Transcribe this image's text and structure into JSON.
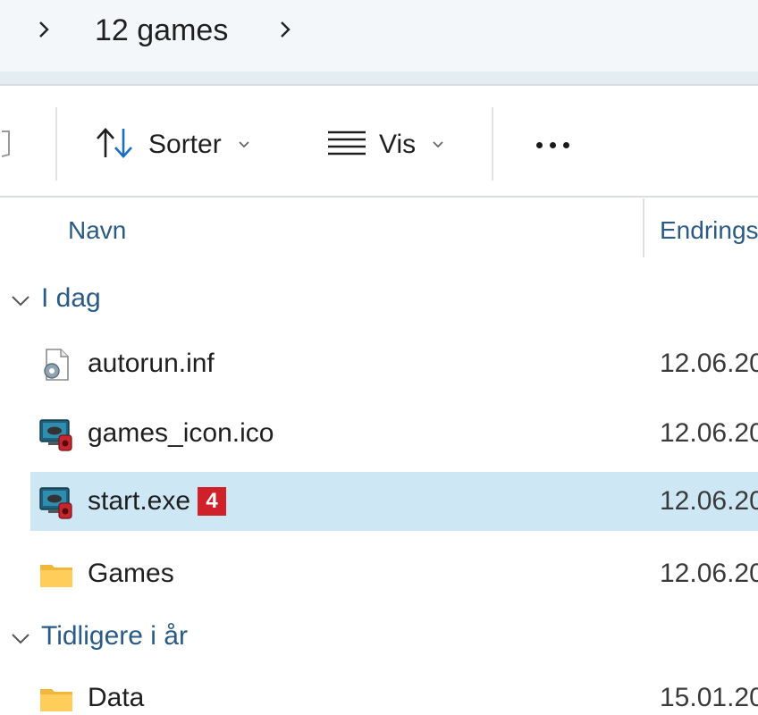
{
  "breadcrumb": {
    "current": "12 games"
  },
  "toolbar": {
    "sort_label": "Sorter",
    "view_label": "Vis"
  },
  "columns": {
    "name": "Navn",
    "modified": "Endrings"
  },
  "groups": [
    {
      "label": "I dag",
      "items": [
        {
          "name": "autorun.inf",
          "date": "12.06.20",
          "icon": "settings-file-icon"
        },
        {
          "name": "games_icon.ico",
          "date": "12.06.20",
          "icon": "games-app-icon"
        },
        {
          "name": "start.exe",
          "date": "12.06.20",
          "icon": "games-app-icon",
          "selected": true,
          "badge": "4"
        },
        {
          "name": "Games",
          "date": "12.06.20",
          "icon": "folder-icon"
        }
      ]
    },
    {
      "label": "Tidligere i år",
      "items": [
        {
          "name": "Data",
          "date": "15.01.20",
          "icon": "folder-icon"
        }
      ]
    }
  ],
  "colors": {
    "accent_text": "#2a5a86",
    "selection": "#cde8f4",
    "badge": "#d0202a"
  }
}
